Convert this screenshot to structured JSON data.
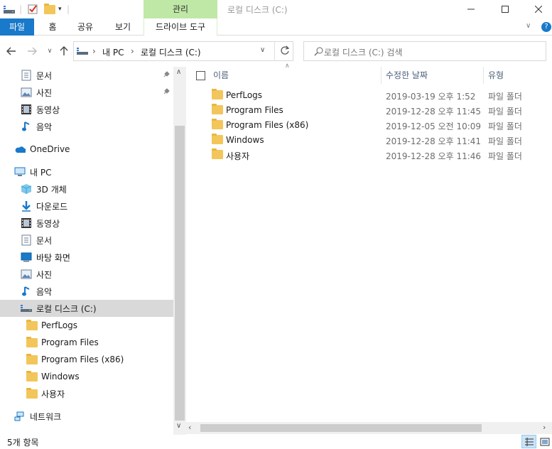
{
  "window": {
    "title": "로컬 디스크 (C:)",
    "context_tab": "관리"
  },
  "ribbon": {
    "tabs": [
      "파일",
      "홈",
      "공유",
      "보기",
      "드라이브 도구"
    ]
  },
  "address": {
    "crumbs": [
      "내 PC",
      "로컬 디스크 (C:)"
    ],
    "search_placeholder": "로컬 디스크 (C:) 검색"
  },
  "nav": {
    "quick": [
      {
        "label": "문서",
        "icon": "documents-icon",
        "pinned": true
      },
      {
        "label": "사진",
        "icon": "pictures-icon",
        "pinned": true
      },
      {
        "label": "동영상",
        "icon": "videos-icon",
        "pinned": false
      },
      {
        "label": "음악",
        "icon": "music-icon",
        "pinned": false
      }
    ],
    "onedrive": "OneDrive",
    "thispc": "내 PC",
    "pc_items": [
      {
        "label": "3D 개체",
        "icon": "3d-objects-icon"
      },
      {
        "label": "다운로드",
        "icon": "downloads-icon"
      },
      {
        "label": "동영상",
        "icon": "videos-icon"
      },
      {
        "label": "문서",
        "icon": "documents-icon"
      },
      {
        "label": "바탕 화면",
        "icon": "desktop-icon"
      },
      {
        "label": "사진",
        "icon": "pictures-icon"
      },
      {
        "label": "음악",
        "icon": "music-icon"
      },
      {
        "label": "로컬 디스크 (C:)",
        "icon": "drive-icon"
      }
    ],
    "drive_children": [
      "PerfLogs",
      "Program Files",
      "Program Files (x86)",
      "Windows",
      "사용자"
    ],
    "network": "네트워크"
  },
  "columns": {
    "name": "이름",
    "modified": "수정한 날짜",
    "type": "유형"
  },
  "files": [
    {
      "name": "PerfLogs",
      "modified": "2019-03-19 오후 1:52",
      "type": "파일 폴더"
    },
    {
      "name": "Program Files",
      "modified": "2019-12-28 오후 11:45",
      "type": "파일 폴더"
    },
    {
      "name": "Program Files (x86)",
      "modified": "2019-12-05 오전 10:09",
      "type": "파일 폴더"
    },
    {
      "name": "Windows",
      "modified": "2019-12-28 오후 11:41",
      "type": "파일 폴더"
    },
    {
      "name": "사용자",
      "modified": "2019-12-28 오후 11:46",
      "type": "파일 폴더"
    }
  ],
  "status": {
    "count": "5개 항목"
  },
  "colors": {
    "accent": "#1979ca",
    "context": "#bfe7a6",
    "selected": "#d9d9d9"
  }
}
